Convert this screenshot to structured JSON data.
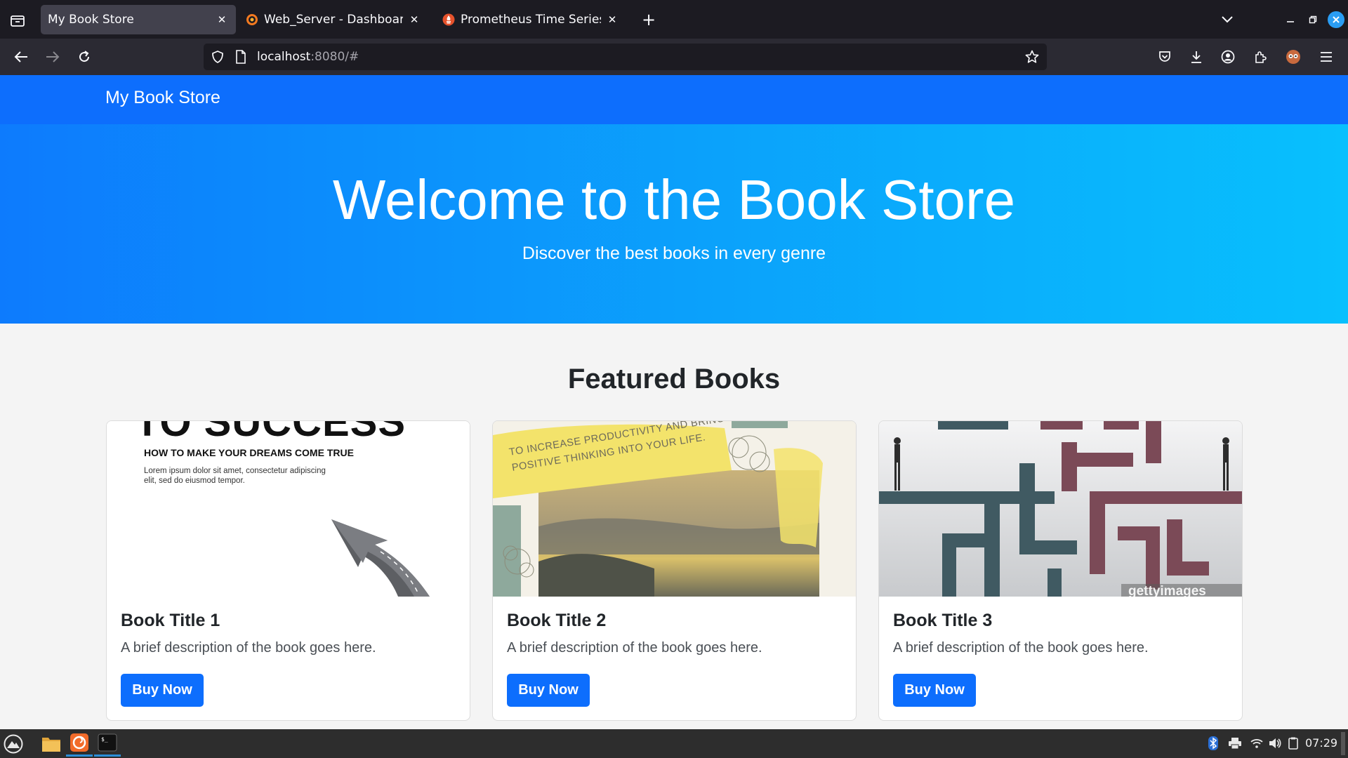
{
  "browser": {
    "tabs": [
      {
        "title": "My Book Store",
        "active": true,
        "favicon": "none"
      },
      {
        "title": "Web_Server - Dashboards - G",
        "active": false,
        "favicon": "grafana-icon"
      },
      {
        "title": "Prometheus Time Series Col",
        "active": false,
        "favicon": "prometheus-icon"
      }
    ],
    "url": {
      "host": "localhost",
      "rest": ":8080/#"
    }
  },
  "site": {
    "brand": "My Book Store",
    "hero": {
      "title": "Welcome to the Book Store",
      "subtitle": "Discover the best books in every genre"
    },
    "featured_title": "Featured Books",
    "books": [
      {
        "title": "Book Title 1",
        "description": "A brief description of the book goes here.",
        "button": "Buy Now",
        "cover": {
          "headline": "TO SUCCESS",
          "subhead": "HOW TO MAKE YOUR DREAMS COME TRUE",
          "body_line1": "Lorem ipsum dolor sit amet, consectetur adipiscing",
          "body_line2": "elit, sed do eiusmod tempor."
        }
      },
      {
        "title": "Book Title 2",
        "description": "A brief description of the book goes here.",
        "button": "Buy Now",
        "cover": {
          "line1": "TO INCREASE PRODUCTIVITY AND BRING",
          "line2": "POSITIVE THINKING INTO YOUR LIFE."
        }
      },
      {
        "title": "Book Title 3",
        "description": "A brief description of the book goes here.",
        "button": "Buy Now",
        "cover": {
          "watermark": "gettyimages"
        }
      }
    ]
  },
  "taskbar": {
    "clock": "07:29"
  },
  "colors": {
    "primary": "#0d6efd",
    "hero_start": "#0d7bfd",
    "hero_end": "#08c0fd",
    "chrome_dark": "#1c1b22",
    "chrome_toolbar": "#2b2a33"
  }
}
